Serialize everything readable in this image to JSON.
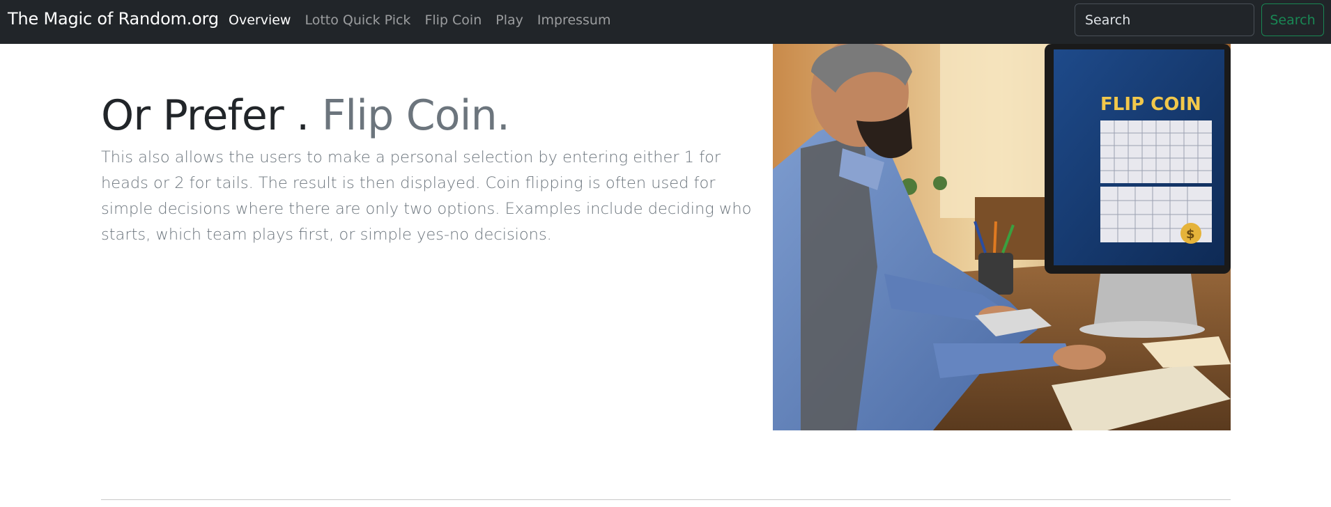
{
  "navbar": {
    "brand": "The Magic of Random.org",
    "links": [
      {
        "label": "Overview",
        "active": true
      },
      {
        "label": "Lotto Quick Pick",
        "active": false
      },
      {
        "label": "Flip Coin",
        "active": false
      },
      {
        "label": "Play",
        "active": false
      },
      {
        "label": "Impressum",
        "active": false
      }
    ],
    "search": {
      "placeholder": "Search",
      "button_label": "Search"
    }
  },
  "hero": {
    "heading_main": "Or Prefer .",
    "heading_muted": "Flip Coin.",
    "lead": "This also allows the users to make a personal selection by entering either 1 for heads or 2 for tails. The result is then displayed. Coin flipping is often used for simple decisions where there are only two options. Examples include deciding who starts, which team plays first, or simple yes-no decisions.",
    "image": {
      "screen_title": "FLIP COIN",
      "coin_symbol": "$"
    }
  },
  "colors": {
    "navbar_bg": "#212529",
    "accent_success": "#198754",
    "muted_text": "#6c757d"
  }
}
